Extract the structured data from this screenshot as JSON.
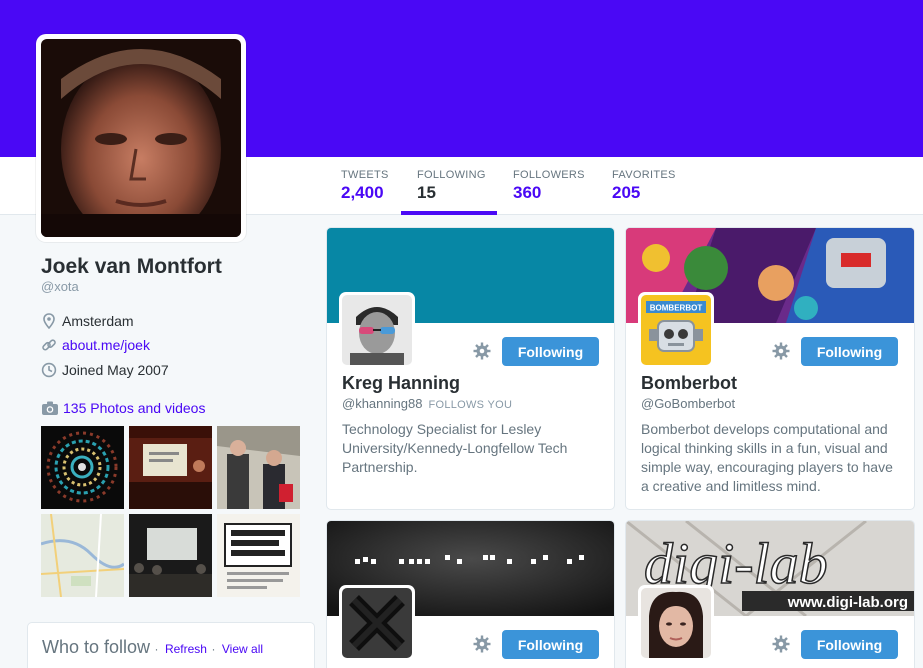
{
  "colors": {
    "theme": "#4a08f5",
    "follow_button": "#3b94d9"
  },
  "profile": {
    "name": "Joek van Montfort",
    "handle": "@xota",
    "location": "Amsterdam",
    "website": "about.me/joek",
    "joined": "Joined May 2007",
    "photos_label": "135 Photos and videos"
  },
  "stats": [
    {
      "label": "TWEETS",
      "value": "2,400",
      "active": false
    },
    {
      "label": "FOLLOWING",
      "value": "15",
      "active": true
    },
    {
      "label": "FOLLOWERS",
      "value": "360",
      "active": false
    },
    {
      "label": "FAVORITES",
      "value": "205",
      "active": false
    }
  ],
  "who_to_follow": {
    "title": "Who to follow",
    "refresh": "Refresh",
    "separator": "·",
    "view_all": "View all"
  },
  "cards": [
    {
      "name": "Kreg Hanning",
      "handle": "@khanning88",
      "follows_you": "FOLLOWS YOU",
      "bio": "Technology Specialist for Lesley University/Kennedy-Longfellow Tech Partnership.",
      "button": "Following",
      "avatar_icon": "person-sunglasses-avatar"
    },
    {
      "name": "Bomberbot",
      "handle": "@GoBomberbot",
      "follows_you": "",
      "bio": "Bomberbot develops computational and logical thinking skills in a fun, visual and simple way, encouraging players to have a creative and limitless mind.",
      "button": "Following",
      "avatar_icon": "robot-avatar",
      "avatar_text": "BOMBERBOT"
    },
    {
      "name": "",
      "handle": "",
      "button": "Following",
      "avatar_icon": "x-logo-avatar"
    },
    {
      "name": "",
      "handle": "",
      "button": "Following",
      "avatar_icon": "woman-avatar",
      "banner_text_large": "digi-lab",
      "banner_text_small": "www.digi-lab.org"
    }
  ]
}
